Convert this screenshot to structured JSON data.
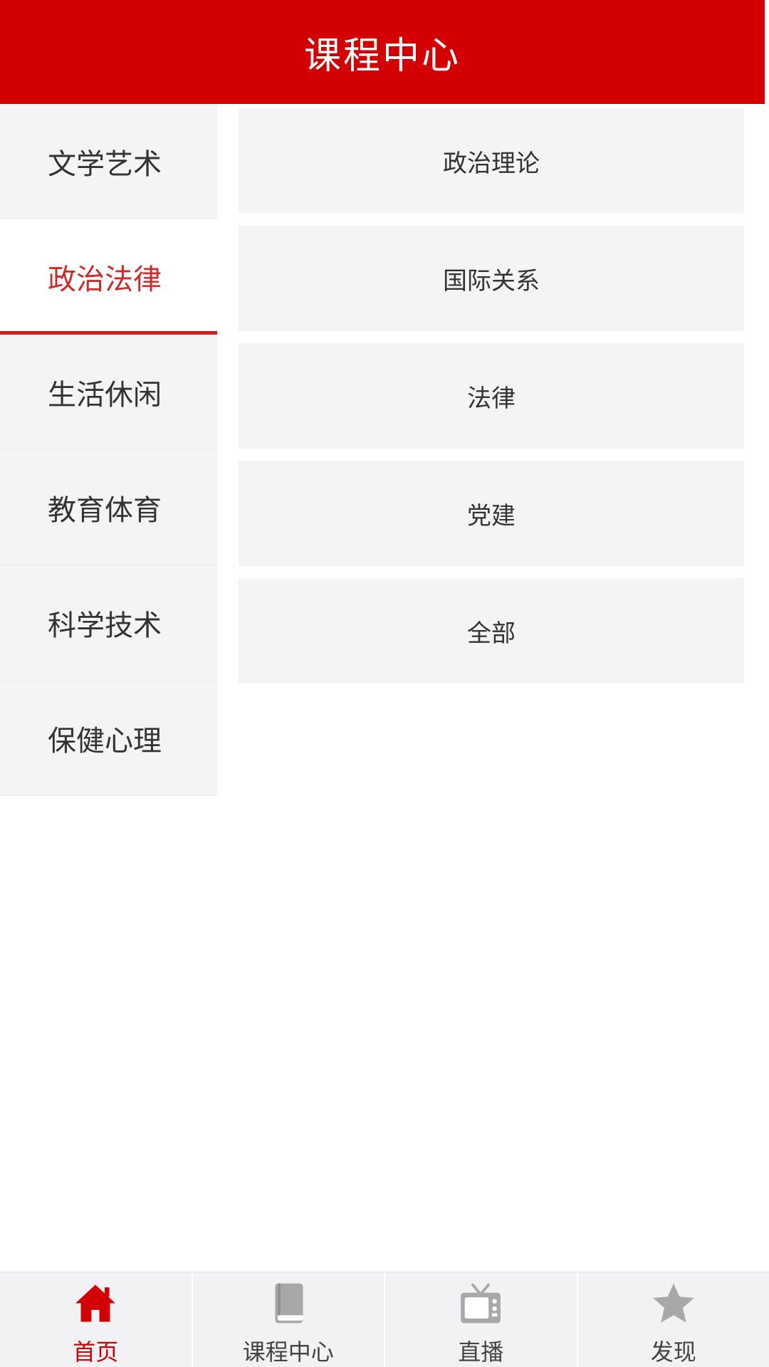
{
  "header": {
    "title": "课程中心"
  },
  "colors": {
    "brand": "#d20003",
    "active_text": "#cf2a2a",
    "inactive_icon": "#a8a8a8"
  },
  "categories": [
    {
      "label": "文学艺术"
    },
    {
      "label": "政治法律",
      "active": true
    },
    {
      "label": "生活休闲"
    },
    {
      "label": "教育体育"
    },
    {
      "label": "科学技术"
    },
    {
      "label": "保健心理"
    }
  ],
  "subcategories": [
    {
      "label": "政治理论"
    },
    {
      "label": "国际关系"
    },
    {
      "label": "法律"
    },
    {
      "label": "党建"
    },
    {
      "label": "全部"
    }
  ],
  "tabbar": [
    {
      "label": "首页",
      "icon": "home-icon",
      "active": true
    },
    {
      "label": "课程中心",
      "icon": "book-icon"
    },
    {
      "label": "直播",
      "icon": "tv-icon"
    },
    {
      "label": "发现",
      "icon": "star-icon"
    }
  ]
}
